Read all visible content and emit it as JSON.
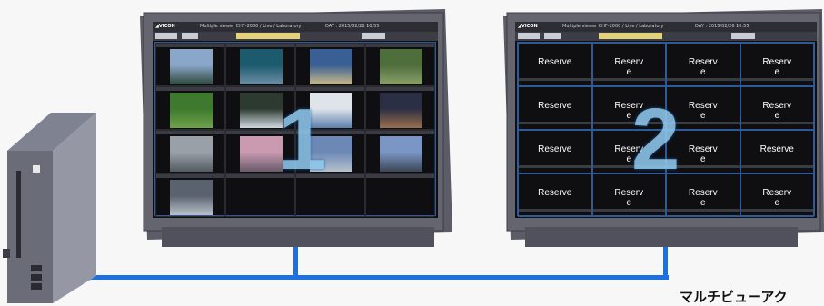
{
  "monitors": [
    {
      "number": "1",
      "app_title": "Multiple viewer  CHF-2000 / Live / Laboratory",
      "datetime": "DAY : 2015/02/26 10:55",
      "tabs": [
        "ALL",
        "CAMERA"
      ],
      "thumb_colors": [
        [
          "#8aa6c8",
          "#2f4a3c"
        ],
        [
          "#1c5a6e",
          "#6d8fa6"
        ],
        [
          "#3a5f94",
          "#c8b88a"
        ],
        [
          "#4e6e3c",
          "#8ba06a"
        ],
        [
          "#3e7a2e",
          "#6fa24a"
        ],
        [
          "#2d3a30",
          "#cfd8e0"
        ],
        [
          "#dfe4ea",
          "#5c7fae"
        ],
        [
          "#2a2f44",
          "#9a6e4c"
        ],
        [
          "#9aa0a8",
          "#555b63"
        ],
        [
          "#c99ab0",
          "#6a5a6c"
        ],
        [
          "#6c88b4",
          "#b7c2cc"
        ],
        [
          "#7a96c4",
          "#3c4656"
        ],
        [
          "#5a6270",
          "#b8c0c8"
        ]
      ]
    },
    {
      "number": "2",
      "app_title": "Multiple viewer  CHF-2000 / Live / Laboratory",
      "datetime": "DAY : 2015/02/26 10:55",
      "tabs": [
        "ALL",
        "CAMERA"
      ],
      "reserve_labels": [
        [
          "Reserve",
          "Reserv\ne",
          "Reserv\ne",
          "Reserv\ne"
        ],
        [
          "Reserve",
          "Reserv\ne",
          "Reserv\ne",
          "Reserv\ne"
        ],
        [
          "Reserve",
          "Reserv\ne",
          "Reserv\ne",
          "Reserve"
        ],
        [
          "Reserve",
          "Reserv\ne",
          "Reserv\ne",
          "Reserv\ne"
        ]
      ]
    }
  ],
  "caption": "マルチビューアク",
  "colors": {
    "cable": "#1e6fe0",
    "numeral": "#8ec8ec",
    "grid_border": "#2f5a9a"
  }
}
